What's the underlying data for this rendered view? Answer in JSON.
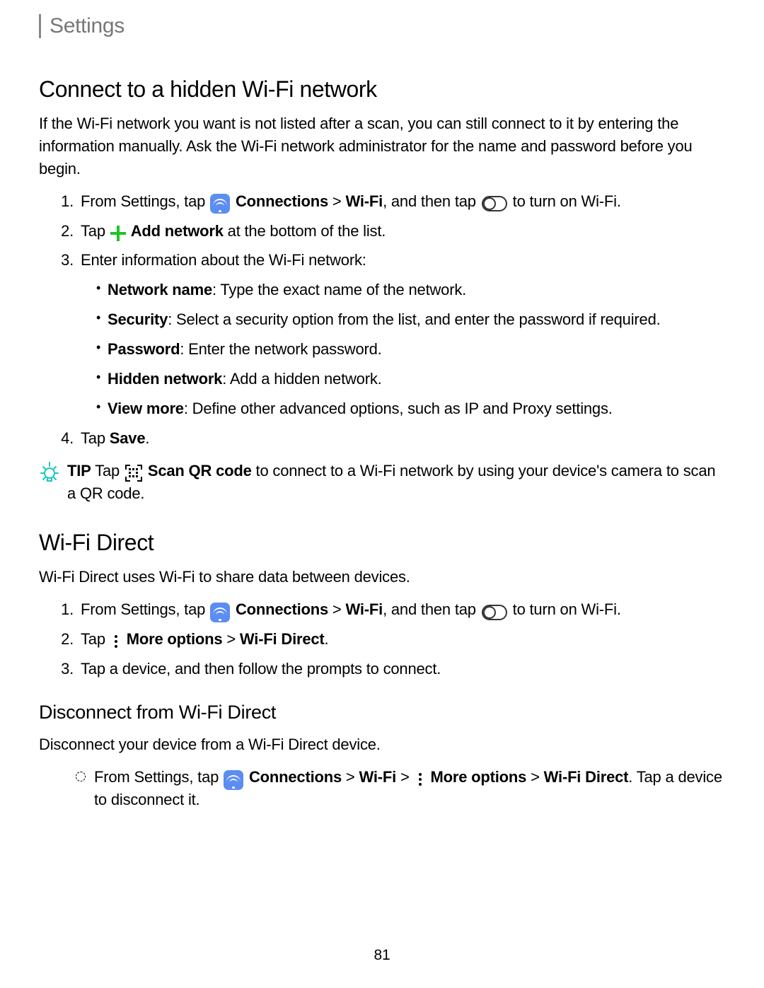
{
  "header": {
    "title": "Settings"
  },
  "s1": {
    "heading": "Connect to a hidden Wi-Fi network",
    "intro": "If the Wi-Fi network you want is not listed after a scan, you can still connect to it by entering the information manually. Ask the Wi-Fi network administrator for the name and password before you begin.",
    "step1_a": "From Settings, tap ",
    "step1_b": "Connections",
    "step1_c": " > ",
    "step1_d": "Wi-Fi",
    "step1_e": ", and then tap ",
    "step1_f": " to turn on Wi-Fi.",
    "step2_a": "Tap ",
    "step2_b": "Add network",
    "step2_c": " at the bottom of the list.",
    "step3": "Enter information about the Wi-Fi network:",
    "sub1_b": "Network name",
    "sub1_t": ": Type the exact name of the network.",
    "sub2_b": "Security",
    "sub2_t": ": Select a security option from the list, and enter the password if required.",
    "sub3_b": "Password",
    "sub3_t": ": Enter the network password.",
    "sub4_b": "Hidden network",
    "sub4_t": ": Add a hidden network.",
    "sub5_b": "View more",
    "sub5_t": ": Define other advanced options, such as IP and Proxy settings.",
    "step4_a": "Tap ",
    "step4_b": "Save",
    "step4_c": "."
  },
  "tip": {
    "label": "TIP",
    "a": "  Tap ",
    "b": "Scan QR code",
    "c": " to connect to a Wi-Fi network by using your device's camera to scan a QR code."
  },
  "s2": {
    "heading": "Wi-Fi Direct",
    "intro": "Wi-Fi Direct uses Wi-Fi to share data between devices.",
    "step1_a": "From Settings, tap ",
    "step1_b": "Connections",
    "step1_c": " > ",
    "step1_d": "Wi-Fi",
    "step1_e": ", and then tap ",
    "step1_f": " to turn on Wi-Fi.",
    "step2_a": "Tap ",
    "step2_b": "More options",
    "step2_c": " > ",
    "step2_d": "Wi-Fi Direct",
    "step2_e": ".",
    "step3": "Tap a device, and then follow the prompts to connect."
  },
  "s3": {
    "heading": "Disconnect from Wi-Fi Direct",
    "intro": "Disconnect your device from a Wi-Fi Direct device.",
    "a": "From Settings, tap ",
    "b": "Connections",
    "c": " > ",
    "d": "Wi-Fi",
    "e": " > ",
    "f": "More options",
    "g": " > ",
    "h": "Wi-Fi Direct",
    "i": ". Tap a device to disconnect it."
  },
  "page": "81"
}
